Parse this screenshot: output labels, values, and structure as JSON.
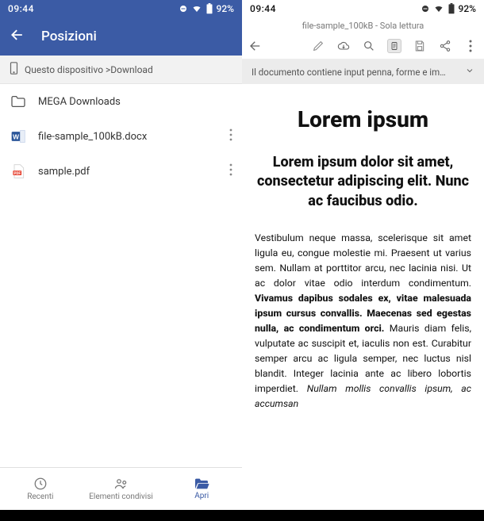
{
  "statusbar": {
    "time": "09:44",
    "battery": "92%"
  },
  "left": {
    "appbar_title": "Posizioni",
    "breadcrumb": "Questo dispositivo >Download",
    "rows": [
      {
        "label": "MEGA Downloads",
        "type": "folder",
        "has_more": false
      },
      {
        "label": "file-sample_100kB.docx",
        "type": "docx",
        "has_more": true
      },
      {
        "label": "sample.pdf",
        "type": "pdf",
        "has_more": true
      }
    ],
    "bottomnav": [
      {
        "label": "Recenti"
      },
      {
        "label": "Elementi condivisi"
      },
      {
        "label": "Apri"
      }
    ]
  },
  "right": {
    "doc_title": "file-sample_100kB - Sola lettura",
    "notice": "Il documento contiene input penna, forme e im…",
    "h1": "Lorem ipsum",
    "h2": "Lorem ipsum dolor sit amet, consectetur adipiscing elit. Nunc ac faucibus odio.",
    "para_plain1": "Vestibulum neque massa, scelerisque sit amet ligula eu, congue molestie mi. Praesent ut varius sem. Nullam at porttitor arcu, nec lacinia nisi. Ut ac dolor vitae odio interdum condimentum. ",
    "para_bold": "Vivamus dapibus sodales ex, vitae malesuada ipsum cursus convallis. Maecenas sed egestas nulla, ac condimentum orci.",
    "para_plain2": " Mauris diam felis, vulputate ac suscipit et, iaculis non est. Curabitur semper arcu ac ligula semper, nec luctus nisl blandit. Integer lacinia ante ac libero lobortis imperdiet. ",
    "para_italic": "Nullam mollis convallis ipsum, ac accumsan"
  }
}
